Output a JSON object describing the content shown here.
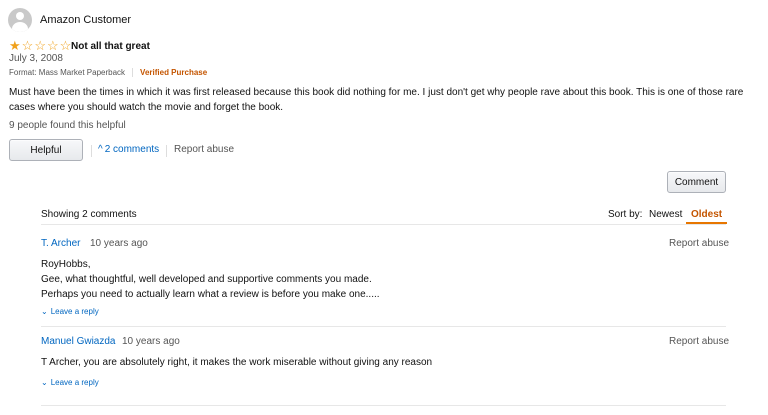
{
  "review": {
    "reviewer_name": "Amazon Customer",
    "rating": 1,
    "rating_max": 5,
    "star_full_glyph": "★",
    "star_empty_glyph": "☆",
    "title": "Not all that great",
    "date": "July 3, 2008",
    "format": "Format: Mass Market Paperback",
    "verified": "Verified Purchase",
    "body": "Must have been the times in which it was first released because this book did nothing for me. I just don't get why people rave about this book. This is one of those rare cases where you should watch the movie and forget the book.",
    "helpful_count_text": "9 people found this helpful",
    "helpful_button": "Helpful",
    "comments_toggle_icon": "^",
    "comments_link": "2 comments",
    "report_abuse": "Report abuse"
  },
  "comments_section": {
    "comment_button": "Comment",
    "showing_text": "Showing 2 comments",
    "sort_label": "Sort by:",
    "sort_newest": "Newest",
    "sort_oldest": "Oldest",
    "active_sort": "Oldest",
    "comments": [
      {
        "author": "T. Archer",
        "time": "10 years ago",
        "report": "Report abuse",
        "lines": [
          "RoyHobbs,",
          "Gee, what thoughtful, well developed and supportive comments you made.",
          "Perhaps you need to actually learn what a review is before you make one....."
        ],
        "reply_icon": "⌄",
        "reply_label": "Leave a reply"
      },
      {
        "author": "Manuel Gwiazda",
        "time": "10 years ago",
        "report": "Report abuse",
        "lines": [
          "T Archer, you are absolutely right, it makes the work miserable without giving any reason"
        ],
        "reply_icon": "⌄",
        "reply_label": "Leave a reply"
      }
    ]
  },
  "colors": {
    "link": "#0066c0",
    "verified": "#c45500",
    "star": "#f0a11c",
    "active_sort_underline": "#e77600"
  }
}
